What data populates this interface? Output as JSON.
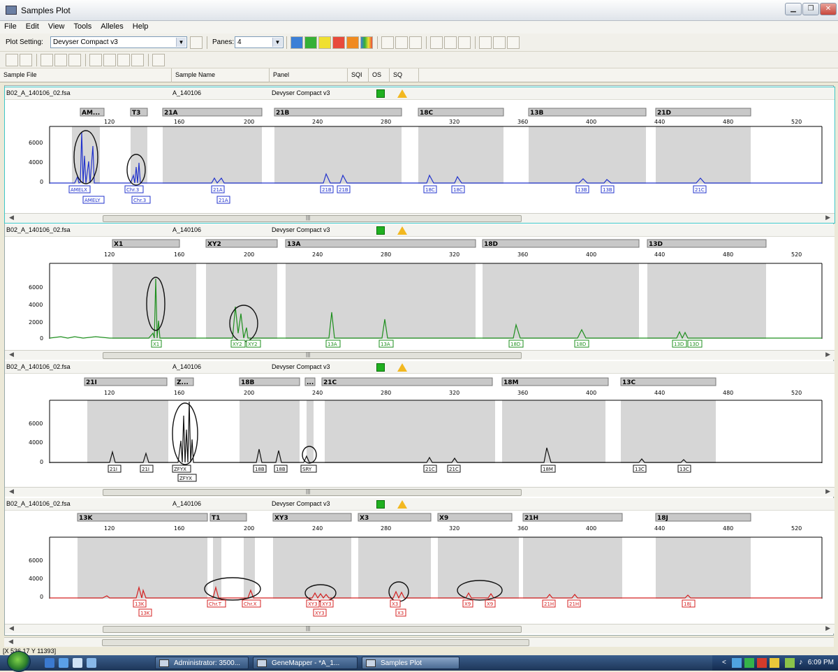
{
  "window": {
    "title": "Samples Plot"
  },
  "menu": [
    "File",
    "Edit",
    "View",
    "Tools",
    "Alleles",
    "Help"
  ],
  "toolbar": {
    "plot_setting_label": "Plot Setting:",
    "plot_setting_value": "Devyser Compact v3",
    "panes_label": "Panes:",
    "panes_value": "4"
  },
  "columns": [
    "Sample File",
    "Sample Name",
    "Panel",
    "SQI",
    "OS",
    "SQ"
  ],
  "axis_ticks": [
    "120",
    "160",
    "200",
    "240",
    "280",
    "320",
    "360",
    "400",
    "440",
    "480",
    "520"
  ],
  "panes": [
    {
      "sample_file": "B02_A_140106_02.fsa",
      "sample_name": "A_140106",
      "panel": "Devyser Compact v3",
      "color": "#2233cc",
      "yticks": [
        "6000",
        "4000",
        "0"
      ],
      "markers": [
        "AM...",
        "T3",
        "21A",
        "21B",
        "18C",
        "13B",
        "21D"
      ],
      "alleles": [
        "AMELX",
        "AMELY",
        "Chr.3",
        "Chr.3",
        "21A",
        "21A",
        "21B",
        "21B",
        "18C",
        "18C",
        "13B",
        "13B",
        "21C"
      ]
    },
    {
      "sample_file": "B02_A_140106_02.fsa",
      "sample_name": "A_140106",
      "panel": "Devyser Compact v3",
      "color": "#1e8f1e",
      "yticks": [
        "6000",
        "4000",
        "2000",
        "0"
      ],
      "markers": [
        "X1",
        "XY2",
        "13A",
        "18D",
        "13D"
      ],
      "alleles": [
        "X1",
        "XY2",
        "XY2",
        "13A",
        "13A",
        "18D",
        "18D",
        "13D",
        "13D"
      ]
    },
    {
      "sample_file": "B02_A_140106_02.fsa",
      "sample_name": "A_140106",
      "panel": "Devyser Compact v3",
      "color": "#111111",
      "yticks": [
        "6000",
        "4000",
        "0"
      ],
      "markers": [
        "21I",
        "Z...",
        "18B",
        "...",
        "21C",
        "18M",
        "13C"
      ],
      "alleles": [
        "21I",
        "21I",
        "ZFYX",
        "ZFYX",
        "18B",
        "18B",
        "SRY",
        "21C",
        "21C",
        "18M",
        "13C",
        "13C"
      ]
    },
    {
      "sample_file": "B02_A_140106_02.fsa",
      "sample_name": "A_140106",
      "panel": "Devyser Compact v3",
      "color": "#d42020",
      "yticks": [
        "6000",
        "4000",
        "0"
      ],
      "markers": [
        "13K",
        "T1",
        "XY3",
        "X3",
        "X9",
        "21H",
        "18J"
      ],
      "alleles": [
        "13K",
        "13K",
        "Chr.T",
        "Chr.X",
        "XY3",
        "XY3",
        "XY3",
        "X3",
        "X3",
        "X9",
        "X9",
        "21H",
        "21H",
        "18J"
      ]
    }
  ],
  "status": "[X 536.17 Y 11393]",
  "taskbar": {
    "tasks": [
      "Administrator: 3500...",
      "GeneMapper - *A_1...",
      "Samples Plot"
    ],
    "time": "6:09 PM"
  }
}
